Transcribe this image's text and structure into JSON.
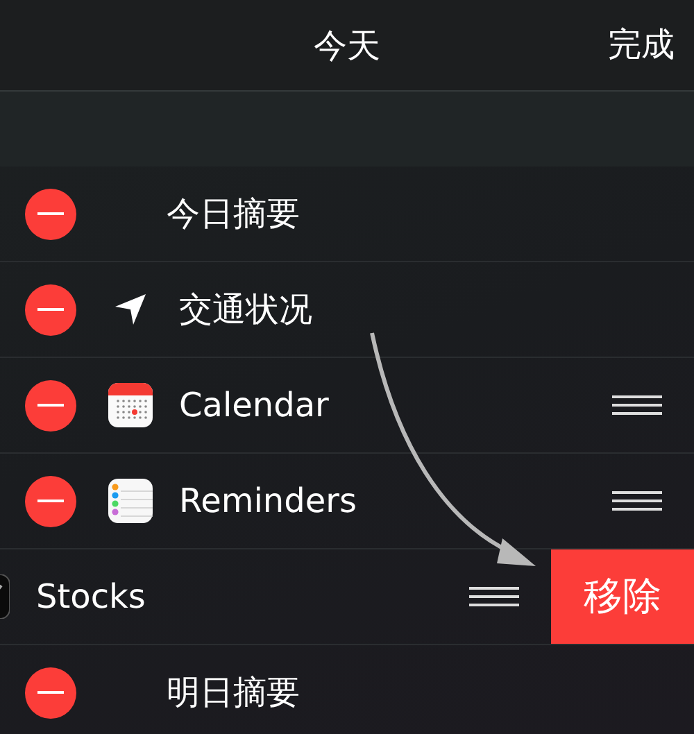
{
  "header": {
    "title": "今天",
    "done": "完成"
  },
  "rows": [
    {
      "label": "今日摘要",
      "kind": "none",
      "handle": false,
      "swiped": false
    },
    {
      "label": "交通状况",
      "kind": "location",
      "handle": false,
      "swiped": false
    },
    {
      "label": "Calendar",
      "kind": "calendar",
      "handle": true,
      "swiped": false
    },
    {
      "label": "Reminders",
      "kind": "reminders",
      "handle": true,
      "swiped": false
    },
    {
      "label": "Stocks",
      "kind": "stocks",
      "handle": true,
      "swiped": true
    },
    {
      "label": "明日摘要",
      "kind": "none",
      "handle": false,
      "swiped": false
    }
  ],
  "remove_button": "移除"
}
